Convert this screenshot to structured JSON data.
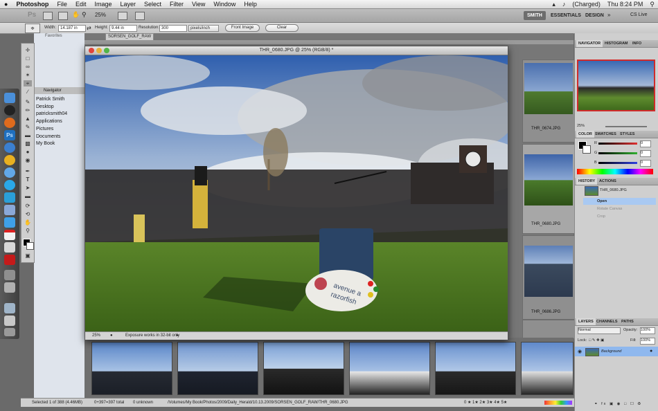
{
  "menubar": {
    "apple_icon": "apple-icon",
    "app_name": "Photoshop",
    "items": [
      "File",
      "Edit",
      "Image",
      "Layer",
      "Select",
      "Filter",
      "View",
      "Window",
      "Help"
    ],
    "battery": "(Charged)",
    "clock": "Thu 8:24 PM"
  },
  "appbar": {
    "ps_logo": "Ps",
    "zoom": "25%",
    "workspace_user": "SMITH",
    "workspace_essentials": "ESSENTIALS",
    "workspace_design": "DESIGN",
    "cs_live": "CS Live"
  },
  "options": {
    "width_label": "Width:",
    "width_value": "14.187 in",
    "height_label": "Height:",
    "height_value": "9.44 in",
    "resolution_label": "Resolution:",
    "resolution_value": "300",
    "resolution_unit": "pixels/inch",
    "front_image": "Front Image",
    "clear": "Clear"
  },
  "finder": {
    "favorites": "Favorites",
    "navigator": "Navigator",
    "places": [
      "Patrick Smith",
      "Desktop",
      "patricksmith04",
      "Applications",
      "Pictures",
      "Documents",
      "My Book"
    ]
  },
  "bridge": {
    "path_tab": "SORSEN_GOLF_RAW",
    "thumb_labels": [
      "THR_0674.JPG",
      "THR_0680.JPG",
      "THR_0686.JPG"
    ]
  },
  "document": {
    "title": "THR_0680.JPG @ 25% (RGB/8) *",
    "zoom": "25%",
    "status": "Exposure works in 32-bit only",
    "signage_line1": "avenue a",
    "signage_line2": "razorfish"
  },
  "navigator_panel": {
    "tabs": [
      "NAVIGATOR",
      "HISTOGRAM",
      "INFO"
    ],
    "zoom": "25%"
  },
  "color_panel": {
    "tabs": [
      "COLOR",
      "SWATCHES",
      "STYLES"
    ],
    "channels": [
      {
        "label": "R",
        "value": "0",
        "color": "#e03030"
      },
      {
        "label": "G",
        "value": "0",
        "color": "#30b030"
      },
      {
        "label": "B",
        "value": "0",
        "color": "#3040e0"
      }
    ]
  },
  "history_panel": {
    "tabs": [
      "HISTORY",
      "ACTIONS"
    ],
    "snapshot": "THR_0680.JPG",
    "steps": [
      "Open",
      "Rotate Canvas",
      "Crop"
    ]
  },
  "layers_panel": {
    "tabs": [
      "LAYERS",
      "CHANNELS",
      "PATHS"
    ],
    "blend_mode": "Normal",
    "opacity_label": "Opacity:",
    "opacity_value": "100%",
    "lock_label": "Lock:",
    "fill_label": "Fill:",
    "fill_value": "100%",
    "layer_name": "Background"
  },
  "bottom": {
    "selected": "Selected 1 of 388 (4.46MB)",
    "counts": "0+397=397 total",
    "unknown": "0 unknown",
    "path": "/Volumes/My Book/Photos/2009/Daily_Herald/10.13.2009/SORSEN_GOLF_RAW/THR_0680.JPG",
    "rating": "0 ★ 1★ 2★ 3★ 4★ 5★"
  },
  "colors": {
    "menubar": "#e6e6e6",
    "panel_bg": "#cfcfcf",
    "history_highlight": "#a9c9f2",
    "layer_highlight": "#8fb8ee"
  }
}
